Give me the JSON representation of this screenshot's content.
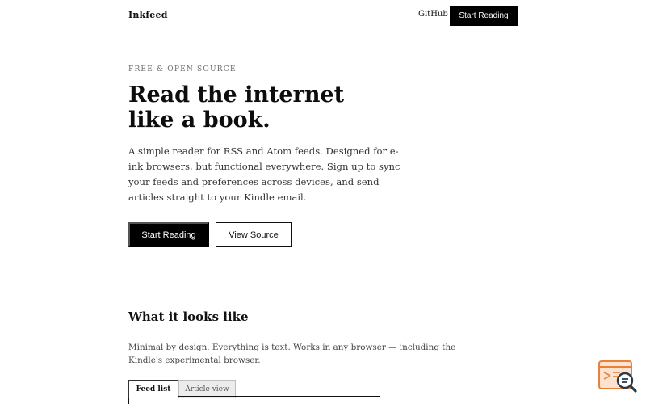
{
  "nav": {
    "brand": "Inkfeed",
    "github_label": "GitHub",
    "cta_label": "Start Reading"
  },
  "hero": {
    "eyebrow": "FREE & OPEN SOURCE",
    "title_line1": "Read the internet",
    "title_line2": "like a book.",
    "description": "A simple reader for RSS and Atom feeds. Designed for e-ink browsers, but functional everywhere. Sign up to sync your feeds and preferences across devices, and send articles straight to your Kindle email.",
    "primary_button": "Start Reading",
    "secondary_button": "View Source"
  },
  "section": {
    "title": "What it looks like",
    "description": "Minimal by design. Everything is text. Works in any browser — including the Kindle's experimental browser.",
    "tabs": [
      {
        "label": "Feed list",
        "active": true
      },
      {
        "label": "Article view",
        "active": false
      }
    ]
  },
  "badge": {
    "icon": "document-search-icon",
    "color": "#e8803a"
  }
}
